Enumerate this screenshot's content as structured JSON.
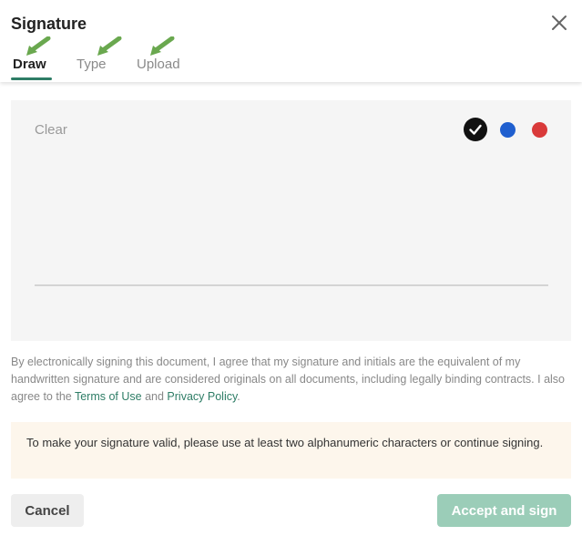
{
  "dialog": {
    "title": "Signature",
    "tabs": [
      {
        "label": "Draw",
        "active": true
      },
      {
        "label": "Type",
        "active": false
      },
      {
        "label": "Upload",
        "active": false
      }
    ]
  },
  "pad": {
    "clear_label": "Clear",
    "colors": [
      {
        "name": "black",
        "hex": "#111111",
        "selected": true
      },
      {
        "name": "blue",
        "hex": "#1f5fcf",
        "selected": false
      },
      {
        "name": "red",
        "hex": "#d93a3a",
        "selected": false
      }
    ]
  },
  "legal": {
    "text_before": "By electronically signing this document, I agree that my signature and initials are the equivalent of my handwritten signature and are considered originals on all documents, including legally binding contracts. I also agree to the ",
    "terms_link": "Terms of Use",
    "and_text": " and ",
    "privacy_link": "Privacy Policy",
    "period": "."
  },
  "notice": {
    "text": "To make your signature valid, please use at least two alphanumeric characters or continue signing."
  },
  "footer": {
    "cancel_label": "Cancel",
    "accept_label": "Accept and sign"
  },
  "colors": {
    "accent": "#2e7d66",
    "accept_disabled": "#9bcdb8",
    "notice_bg": "#fdf6ec",
    "annotation_arrow": "#6aa84f"
  }
}
